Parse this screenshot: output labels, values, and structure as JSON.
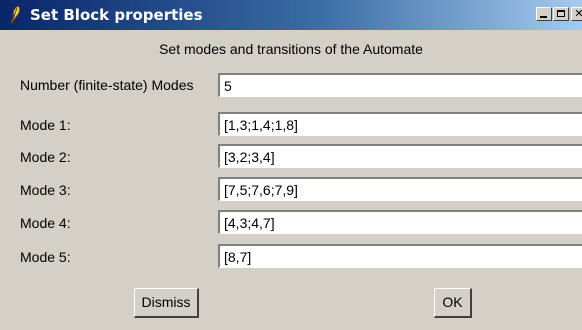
{
  "window": {
    "title": "Set Block properties",
    "titlebar_colors": [
      "#0a246a",
      "#a6caf0"
    ]
  },
  "dialog": {
    "subtitle": "Set modes and transitions of the Automate",
    "fields": [
      {
        "label": "Number (finite-state) Modes",
        "value": "5"
      },
      {
        "label": "Mode 1:",
        "value": "[1,3;1,4;1,8]"
      },
      {
        "label": "Mode 2:",
        "value": "[3,2;3,4]"
      },
      {
        "label": "Mode 3:",
        "value": "[7,5;7,6;7,9]"
      },
      {
        "label": "Mode 4:",
        "value": "[4,3;4,7]"
      },
      {
        "label": "Mode 5:",
        "value": "[8,7]"
      }
    ],
    "buttons": {
      "dismiss": "Dismiss",
      "ok": "OK"
    }
  },
  "icons": {
    "app": "feather-icon",
    "minimize": "minimize-icon",
    "maximize": "maximize-icon",
    "close": "close-icon"
  }
}
